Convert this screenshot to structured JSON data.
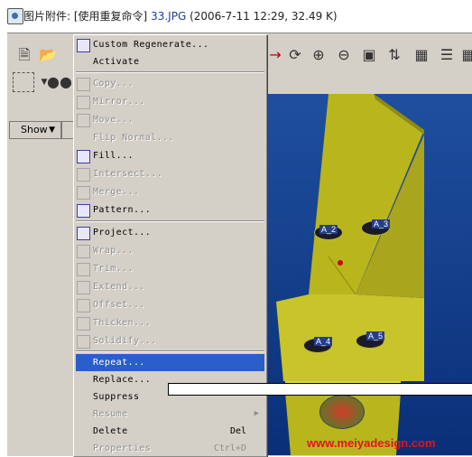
{
  "attachment": {
    "prefix": "图片附件:",
    "title": "[使用重复命令]",
    "filename": "33.JPG",
    "meta": "(2006-7-11 12:29, 32.49 K)"
  },
  "toolbar": {
    "show_label": "Show"
  },
  "menu": {
    "items": [
      {
        "label": "Custom Regenerate...",
        "enabled": true,
        "icon": "regenerate-icon"
      },
      {
        "label": "Activate",
        "enabled": true
      },
      {
        "label": "Copy...",
        "enabled": false,
        "icon": "copy-icon"
      },
      {
        "label": "Mirror...",
        "enabled": false,
        "icon": "mirror-icon"
      },
      {
        "label": "Move...",
        "enabled": false,
        "icon": "move-icon"
      },
      {
        "label": "Flip Normal...",
        "enabled": false
      },
      {
        "label": "Fill...",
        "enabled": true,
        "icon": "fill-icon"
      },
      {
        "label": "Intersect...",
        "enabled": false,
        "icon": "intersect-icon"
      },
      {
        "label": "Merge...",
        "enabled": false,
        "icon": "merge-icon"
      },
      {
        "label": "Pattern...",
        "enabled": true,
        "icon": "pattern-icon"
      },
      {
        "label": "Project...",
        "enabled": true,
        "icon": "project-icon"
      },
      {
        "label": "Wrap...",
        "enabled": false,
        "icon": "wrap-icon"
      },
      {
        "label": "Trim...",
        "enabled": false,
        "icon": "trim-icon"
      },
      {
        "label": "Extend...",
        "enabled": false,
        "icon": "extend-icon"
      },
      {
        "label": "Offset...",
        "enabled": false,
        "icon": "offset-icon"
      },
      {
        "label": "Thicken...",
        "enabled": false,
        "icon": "thicken-icon"
      },
      {
        "label": "Solidify...",
        "enabled": false,
        "icon": "solidify-icon"
      },
      {
        "label": "Repeat...",
        "enabled": true,
        "selected": true
      },
      {
        "label": "Replace...",
        "enabled": true
      },
      {
        "label": "Suppress",
        "enabled": true
      },
      {
        "label": "Resume",
        "enabled": false,
        "submenu": true
      },
      {
        "label": "Delete",
        "enabled": true,
        "shortcut": "Del"
      },
      {
        "label": "Properties",
        "enabled": false,
        "shortcut": "Ctrl+D"
      }
    ]
  },
  "viewport": {
    "labels": [
      "A_2",
      "A_3",
      "A_4",
      "A_5"
    ]
  },
  "watermark": "www.meiyadesign.com"
}
